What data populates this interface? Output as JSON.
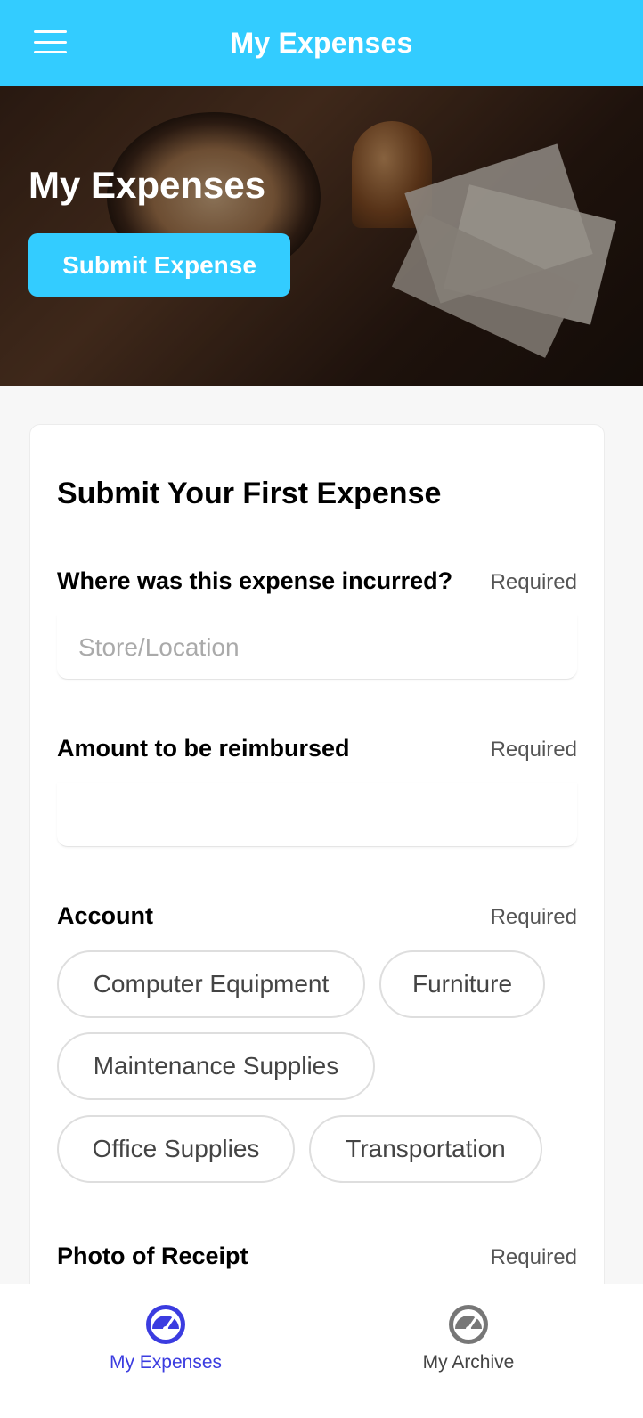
{
  "header": {
    "title": "My Expenses",
    "menu_icon": "hamburger-menu-icon",
    "background_color": "#33ccff"
  },
  "hero": {
    "heading": "My Expenses",
    "button_label": "Submit Expense"
  },
  "form": {
    "title": "Submit Your First Expense",
    "fields": {
      "location": {
        "label": "Where was this expense incurred?",
        "required_text": "Required",
        "placeholder": "Store/Location",
        "value": ""
      },
      "amount": {
        "label": "Amount to be reimbursed",
        "required_text": "Required",
        "placeholder": "",
        "value": ""
      },
      "account": {
        "label": "Account",
        "required_text": "Required",
        "options": [
          "Computer Equipment",
          "Furniture",
          "Maintenance Supplies",
          "Office Supplies",
          "Transportation"
        ]
      },
      "receipt": {
        "label": "Photo of Receipt",
        "required_text": "Required"
      }
    }
  },
  "bottom_nav": {
    "items": [
      {
        "label": "My Expenses",
        "icon": "speedometer-icon",
        "active": true
      },
      {
        "label": "My Archive",
        "icon": "speedometer-icon",
        "active": false
      }
    ],
    "active_color": "#3b3ce0",
    "inactive_color": "#666666"
  }
}
